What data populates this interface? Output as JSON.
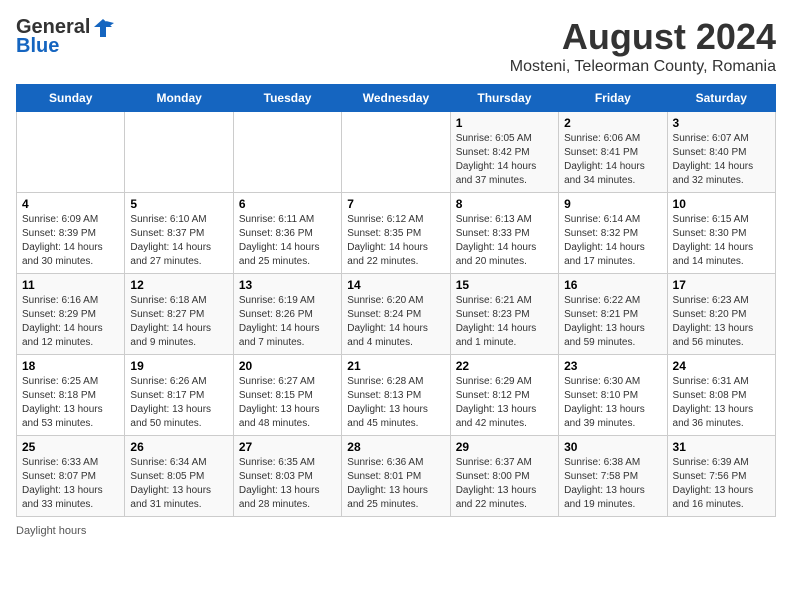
{
  "header": {
    "logo_general": "General",
    "logo_blue": "Blue",
    "month_year": "August 2024",
    "location": "Mosteni, Teleorman County, Romania"
  },
  "weekdays": [
    "Sunday",
    "Monday",
    "Tuesday",
    "Wednesday",
    "Thursday",
    "Friday",
    "Saturday"
  ],
  "weeks": [
    [
      {
        "day": "",
        "sunrise": "",
        "sunset": "",
        "daylight": ""
      },
      {
        "day": "",
        "sunrise": "",
        "sunset": "",
        "daylight": ""
      },
      {
        "day": "",
        "sunrise": "",
        "sunset": "",
        "daylight": ""
      },
      {
        "day": "",
        "sunrise": "",
        "sunset": "",
        "daylight": ""
      },
      {
        "day": "1",
        "sunrise": "Sunrise: 6:05 AM",
        "sunset": "Sunset: 8:42 PM",
        "daylight": "Daylight: 14 hours and 37 minutes."
      },
      {
        "day": "2",
        "sunrise": "Sunrise: 6:06 AM",
        "sunset": "Sunset: 8:41 PM",
        "daylight": "Daylight: 14 hours and 34 minutes."
      },
      {
        "day": "3",
        "sunrise": "Sunrise: 6:07 AM",
        "sunset": "Sunset: 8:40 PM",
        "daylight": "Daylight: 14 hours and 32 minutes."
      }
    ],
    [
      {
        "day": "4",
        "sunrise": "Sunrise: 6:09 AM",
        "sunset": "Sunset: 8:39 PM",
        "daylight": "Daylight: 14 hours and 30 minutes."
      },
      {
        "day": "5",
        "sunrise": "Sunrise: 6:10 AM",
        "sunset": "Sunset: 8:37 PM",
        "daylight": "Daylight: 14 hours and 27 minutes."
      },
      {
        "day": "6",
        "sunrise": "Sunrise: 6:11 AM",
        "sunset": "Sunset: 8:36 PM",
        "daylight": "Daylight: 14 hours and 25 minutes."
      },
      {
        "day": "7",
        "sunrise": "Sunrise: 6:12 AM",
        "sunset": "Sunset: 8:35 PM",
        "daylight": "Daylight: 14 hours and 22 minutes."
      },
      {
        "day": "8",
        "sunrise": "Sunrise: 6:13 AM",
        "sunset": "Sunset: 8:33 PM",
        "daylight": "Daylight: 14 hours and 20 minutes."
      },
      {
        "day": "9",
        "sunrise": "Sunrise: 6:14 AM",
        "sunset": "Sunset: 8:32 PM",
        "daylight": "Daylight: 14 hours and 17 minutes."
      },
      {
        "day": "10",
        "sunrise": "Sunrise: 6:15 AM",
        "sunset": "Sunset: 8:30 PM",
        "daylight": "Daylight: 14 hours and 14 minutes."
      }
    ],
    [
      {
        "day": "11",
        "sunrise": "Sunrise: 6:16 AM",
        "sunset": "Sunset: 8:29 PM",
        "daylight": "Daylight: 14 hours and 12 minutes."
      },
      {
        "day": "12",
        "sunrise": "Sunrise: 6:18 AM",
        "sunset": "Sunset: 8:27 PM",
        "daylight": "Daylight: 14 hours and 9 minutes."
      },
      {
        "day": "13",
        "sunrise": "Sunrise: 6:19 AM",
        "sunset": "Sunset: 8:26 PM",
        "daylight": "Daylight: 14 hours and 7 minutes."
      },
      {
        "day": "14",
        "sunrise": "Sunrise: 6:20 AM",
        "sunset": "Sunset: 8:24 PM",
        "daylight": "Daylight: 14 hours and 4 minutes."
      },
      {
        "day": "15",
        "sunrise": "Sunrise: 6:21 AM",
        "sunset": "Sunset: 8:23 PM",
        "daylight": "Daylight: 14 hours and 1 minute."
      },
      {
        "day": "16",
        "sunrise": "Sunrise: 6:22 AM",
        "sunset": "Sunset: 8:21 PM",
        "daylight": "Daylight: 13 hours and 59 minutes."
      },
      {
        "day": "17",
        "sunrise": "Sunrise: 6:23 AM",
        "sunset": "Sunset: 8:20 PM",
        "daylight": "Daylight: 13 hours and 56 minutes."
      }
    ],
    [
      {
        "day": "18",
        "sunrise": "Sunrise: 6:25 AM",
        "sunset": "Sunset: 8:18 PM",
        "daylight": "Daylight: 13 hours and 53 minutes."
      },
      {
        "day": "19",
        "sunrise": "Sunrise: 6:26 AM",
        "sunset": "Sunset: 8:17 PM",
        "daylight": "Daylight: 13 hours and 50 minutes."
      },
      {
        "day": "20",
        "sunrise": "Sunrise: 6:27 AM",
        "sunset": "Sunset: 8:15 PM",
        "daylight": "Daylight: 13 hours and 48 minutes."
      },
      {
        "day": "21",
        "sunrise": "Sunrise: 6:28 AM",
        "sunset": "Sunset: 8:13 PM",
        "daylight": "Daylight: 13 hours and 45 minutes."
      },
      {
        "day": "22",
        "sunrise": "Sunrise: 6:29 AM",
        "sunset": "Sunset: 8:12 PM",
        "daylight": "Daylight: 13 hours and 42 minutes."
      },
      {
        "day": "23",
        "sunrise": "Sunrise: 6:30 AM",
        "sunset": "Sunset: 8:10 PM",
        "daylight": "Daylight: 13 hours and 39 minutes."
      },
      {
        "day": "24",
        "sunrise": "Sunrise: 6:31 AM",
        "sunset": "Sunset: 8:08 PM",
        "daylight": "Daylight: 13 hours and 36 minutes."
      }
    ],
    [
      {
        "day": "25",
        "sunrise": "Sunrise: 6:33 AM",
        "sunset": "Sunset: 8:07 PM",
        "daylight": "Daylight: 13 hours and 33 minutes."
      },
      {
        "day": "26",
        "sunrise": "Sunrise: 6:34 AM",
        "sunset": "Sunset: 8:05 PM",
        "daylight": "Daylight: 13 hours and 31 minutes."
      },
      {
        "day": "27",
        "sunrise": "Sunrise: 6:35 AM",
        "sunset": "Sunset: 8:03 PM",
        "daylight": "Daylight: 13 hours and 28 minutes."
      },
      {
        "day": "28",
        "sunrise": "Sunrise: 6:36 AM",
        "sunset": "Sunset: 8:01 PM",
        "daylight": "Daylight: 13 hours and 25 minutes."
      },
      {
        "day": "29",
        "sunrise": "Sunrise: 6:37 AM",
        "sunset": "Sunset: 8:00 PM",
        "daylight": "Daylight: 13 hours and 22 minutes."
      },
      {
        "day": "30",
        "sunrise": "Sunrise: 6:38 AM",
        "sunset": "Sunset: 7:58 PM",
        "daylight": "Daylight: 13 hours and 19 minutes."
      },
      {
        "day": "31",
        "sunrise": "Sunrise: 6:39 AM",
        "sunset": "Sunset: 7:56 PM",
        "daylight": "Daylight: 13 hours and 16 minutes."
      }
    ]
  ],
  "footer": {
    "daylight_label": "Daylight hours"
  }
}
